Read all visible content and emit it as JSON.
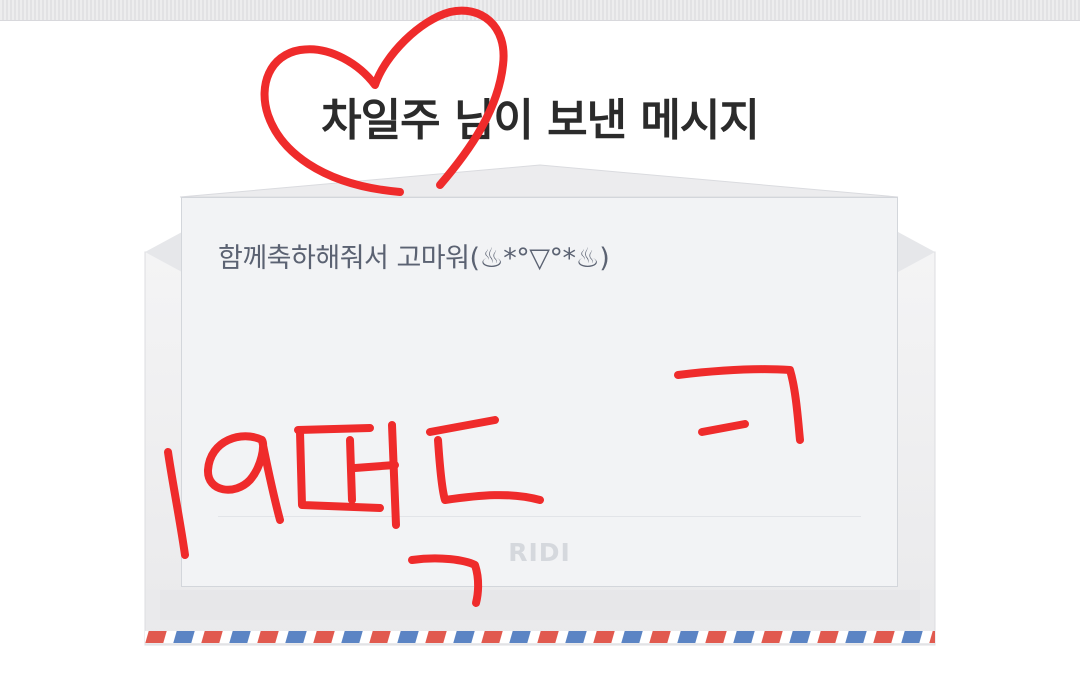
{
  "header": {
    "title": "차일주 님이 보낸 메시지"
  },
  "letter": {
    "message": "함께축하해줘서 고마워(♨*°▽°*♨)",
    "brand": "RIDI"
  },
  "colors": {
    "airmail_red": "#e15a4f",
    "airmail_blue": "#5b84c4",
    "doodle_red": "#ef2b2b",
    "card_bg": "#f2f3f5"
  },
  "icons": {
    "heart": "heart-doodle-icon"
  }
}
